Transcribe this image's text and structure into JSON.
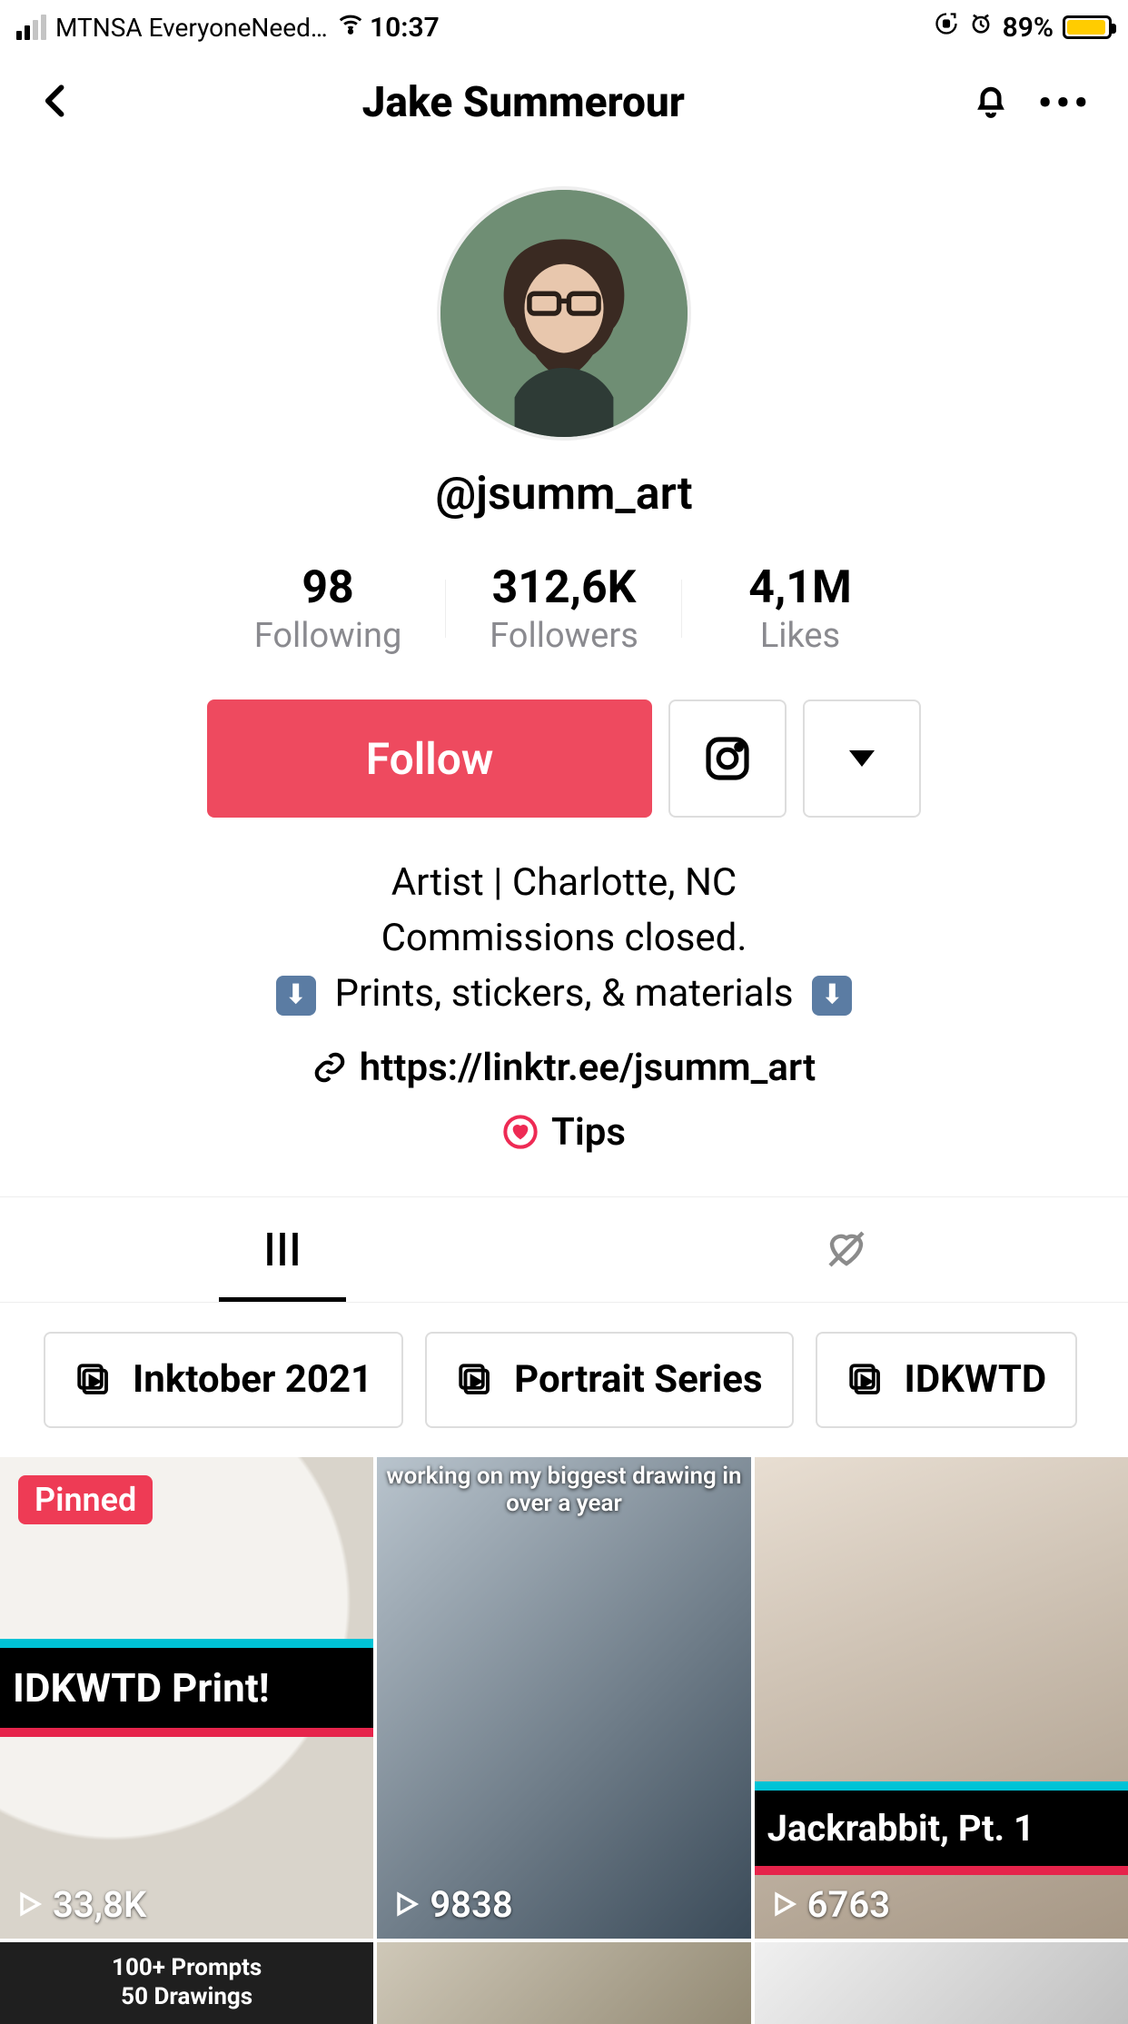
{
  "status": {
    "carrier": "MTNSA EveryoneNeed...",
    "time": "10:37",
    "battery_pct": "89%"
  },
  "nav": {
    "title": "Jake Summerour"
  },
  "profile": {
    "handle": "@jsumm_art",
    "stats": {
      "following": {
        "value": "98",
        "label": "Following"
      },
      "followers": {
        "value": "312,6K",
        "label": "Followers"
      },
      "likes": {
        "value": "4,1M",
        "label": "Likes"
      }
    },
    "follow_label": "Follow",
    "bio_line1": "Artist | Charlotte, NC",
    "bio_line2": "Commissions closed.",
    "bio_line3": "Prints, stickers, & materials",
    "link": "https://linktr.ee/jsumm_art",
    "tips_label": "Tips"
  },
  "playlists": [
    {
      "label": "Inktober 2021"
    },
    {
      "label": "Portrait Series"
    },
    {
      "label": "IDKWTD"
    }
  ],
  "videos": [
    {
      "pinned": true,
      "pinned_label": "Pinned",
      "views": "33,8K",
      "overlay": "IDKWTD Print!",
      "caption": ""
    },
    {
      "pinned": false,
      "views": "9838",
      "overlay": "",
      "caption": "working on my biggest drawing in over a year"
    },
    {
      "pinned": false,
      "views": "6763",
      "overlay": "Jackrabbit, Pt. 1",
      "caption": ""
    }
  ],
  "videos_row2": [
    {
      "caption": "100+ Prompts\n50 Drawings"
    },
    {
      "caption": ""
    },
    {
      "caption": ""
    }
  ]
}
